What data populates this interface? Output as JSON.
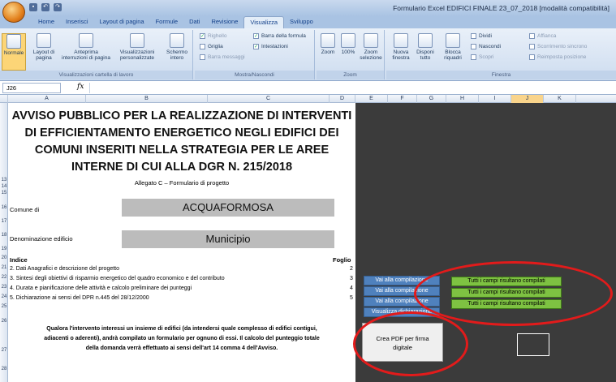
{
  "window": {
    "title": "Formulario Excel EDIFICI FINALE 23_07_2018 [modalità compatibilità]"
  },
  "ribbon": {
    "tabs": [
      "Home",
      "Inserisci",
      "Layout di pagina",
      "Formule",
      "Dati",
      "Revisione",
      "Visualizza",
      "Sviluppo"
    ],
    "active_tab": "Visualizza",
    "groups": {
      "views": "Visualizzazioni cartella di lavoro",
      "show": "Mostra/Nascondi",
      "zoom": "Zoom",
      "window": "Finestra"
    },
    "views_buttons": [
      "Normale",
      "Layout di pagina",
      "Anteprima interruzioni di pagina",
      "Visualizzazioni personalizzate",
      "Schermo intero"
    ],
    "show_checks": [
      {
        "label": "Righello",
        "checked": true,
        "disabled": true
      },
      {
        "label": "Barra della formula",
        "checked": true
      },
      {
        "label": "Griglia",
        "checked": false
      },
      {
        "label": "Intestazioni",
        "checked": true
      },
      {
        "label": "Barra messaggi",
        "checked": false,
        "disabled": true
      }
    ],
    "zoom_buttons": [
      "Zoom",
      "100%",
      "Zoom selezione"
    ],
    "window_buttons": [
      "Nuova finestra",
      "Disponi tutto",
      "Blocca riquadri"
    ],
    "window_small": [
      "Dividi",
      "Nascondi",
      "Scopri",
      "Affianca",
      "Scorrimento sincrono",
      "Reimposta posizione"
    ]
  },
  "formula_bar": {
    "name_box": "J26",
    "fx": "fx",
    "value": ""
  },
  "columns": [
    "A",
    "B",
    "C",
    "D",
    "E",
    "F",
    "G",
    "H",
    "I",
    "J",
    "K"
  ],
  "selected_column": "J",
  "rows": [
    "13",
    "14",
    "15",
    "16",
    "17",
    "18",
    "19",
    "20",
    "21",
    "22",
    "23",
    "24",
    "25",
    "26",
    "27",
    "28"
  ],
  "sheet": {
    "title_lines": [
      "AVVISO PUBBLICO PER LA REALIZZAZIONE DI INTERVENTI",
      "DI EFFICIENTAMENTO ENERGETICO NEGLI EDIFICI DEI",
      "COMUNI INSERITI NELLA STRATEGIA PER LE AREE",
      "INTERNE DI CUI ALLA DGR N. 215/2018"
    ],
    "subtitle": "Allegato C – Formulario di progetto",
    "comune_label": "Comune di",
    "comune_value": "ACQUAFORMOSA",
    "edificio_label": "Denominazione edificio",
    "edificio_value": "Municipio",
    "index_label": "Indice",
    "foglio_label": "Foglio",
    "index_items": [
      {
        "text": "2. Dati Anagrafici e descrizione del progetto",
        "sheet": "2"
      },
      {
        "text": "3. Sintesi degli obiettivi di risparmio energetico del quadro economico e del contributo",
        "sheet": "3"
      },
      {
        "text": "4. Durata e pianificazione delle attività e calcolo preliminare dei punteggi",
        "sheet": "4"
      },
      {
        "text": "5. Dichiarazione ai sensi del DPR n.445 del 28/12/2000",
        "sheet": "5"
      }
    ],
    "note_lines": [
      "Qualora l'intervento interessi un insieme di edifici (da intendersi quale complesso di edifici contigui,",
      "adiacenti o aderenti), andrà compilato un formulario per ognuno di essi. Il calcolo del punteggio totale",
      "della domanda verrà effettuato ai sensi dell'art 14 comma 4 dell'Avviso."
    ]
  },
  "controls": {
    "blue_buttons": [
      "Vai alla compilazione",
      "Vai alla compilazione",
      "Vai alla compilazione",
      "Visualizza dichiarazione"
    ],
    "status_boxes": [
      "Tutti i campi risultano compilati",
      "Tutti i campi risultano compilati",
      "Tutti i campi risultano compilati"
    ],
    "pdf_line1": "Crea PDF per firma",
    "pdf_line2": "digitale"
  },
  "colors": {
    "dark_area": "#3b3b3b",
    "blue_button": "#4f81bd",
    "green_box": "#7ec242",
    "annotation_ring": "#e21b1b"
  }
}
